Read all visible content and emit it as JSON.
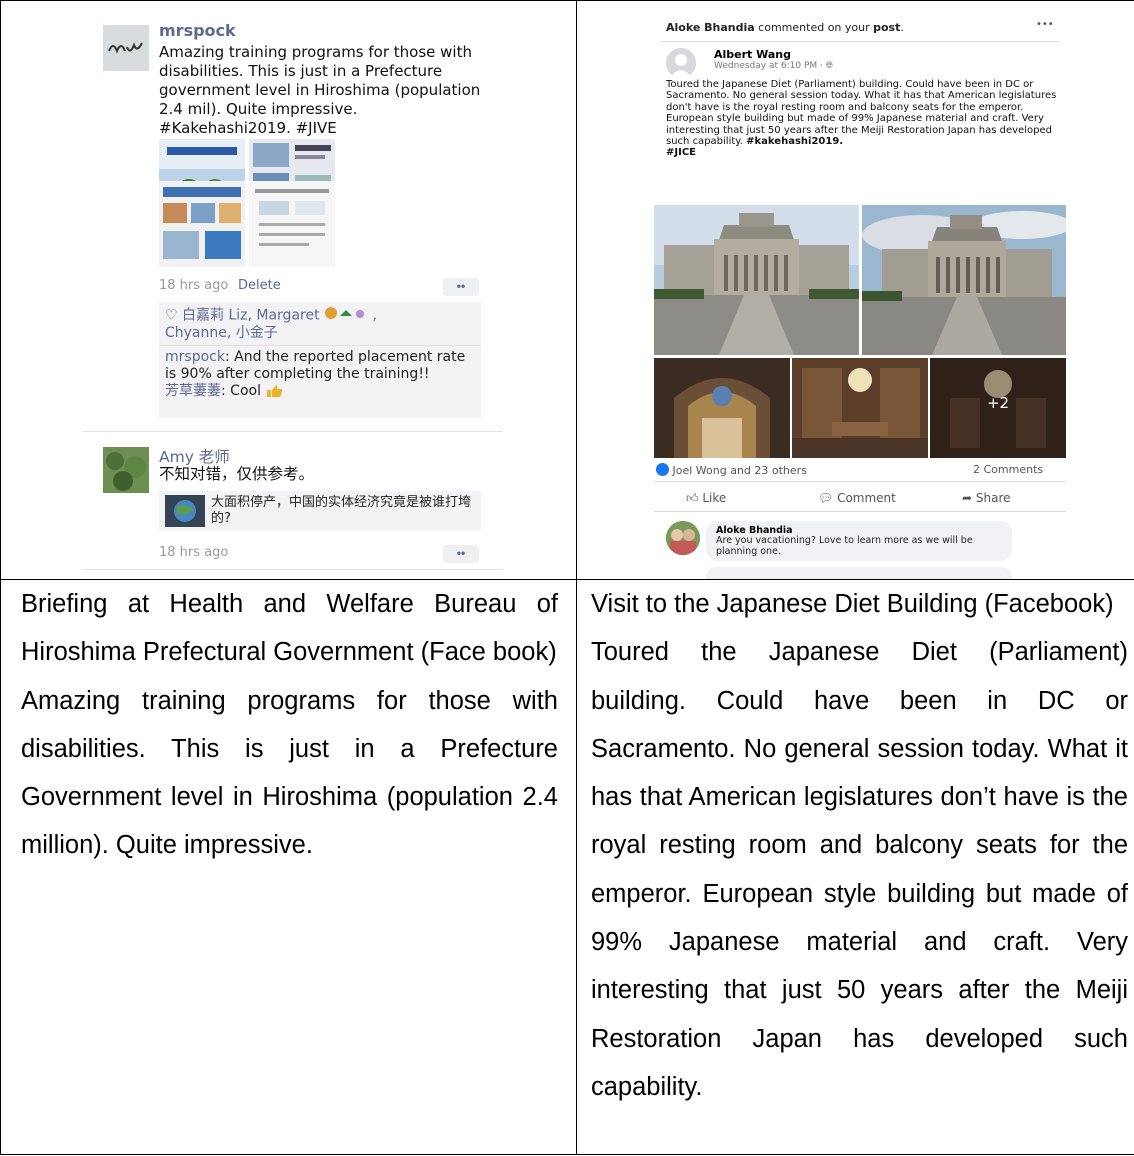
{
  "left_post": {
    "author": "mrspock",
    "body": "Amazing training programs for those with disabilities. This is just in a Prefecture government level in Hiroshima (population 2.4 mil). Quite impressive. #Kakehashi2019. #JIVE",
    "time": "18 hrs ago",
    "delete_label": "Delete",
    "more_label": "••",
    "likes_prefix": "♡ 白嘉莉 Liz, Margaret",
    "likes_tail": ",",
    "likes_line2": "Chyanne, 小金子",
    "comment1_author": "mrspock",
    "comment1_text": ": And the reported placement rate is 90% after completing the training!!",
    "comment2_author": "芳草萋萋",
    "comment2_text": ": Cool",
    "second_author": "Amy 老师",
    "second_text": "不知对错，仅供参考。",
    "share_title": "大面积停产，中国的实体经济究竟是被谁打垮的?",
    "second_time": "18 hrs ago",
    "second_more": "••"
  },
  "right_post": {
    "notif_name": "Aloke Bhandia",
    "notif_mid": " commented on your ",
    "notif_post": "post",
    "notif_end": ".",
    "notif_more": "•••",
    "author": "Albert Wang",
    "meta": "Wednesday at 6:10 PM · ",
    "body": "Toured the Japanese Diet (Parliament) building. Could have been in DC or Sacramento. No general session today. What it has that American legislatures don't have is the royal resting room and balcony seats for the emperor. European style building but made of 99% Japanese material and craft. Very interesting that just 50 years after the Meiji Restoration Japan has developed such capability.",
    "hashtags": "#kakehashi2019.",
    "hashtag2": "#JICE",
    "more_photos": "+2",
    "reactions": "Joel Wong and 23 others",
    "comments_count": "2 Comments",
    "like_label": "Like",
    "comment_label": "Comment",
    "share_label": "Share",
    "commenter": "Aloke Bhandia",
    "comment_text": "Are you vacationing? Love to learn more as we will be planning one."
  },
  "captions": {
    "left_title": "Briefing at Health and Welfare Bureau of Hiroshima Prefectural Government (Face book)",
    "left_body": "Amazing training programs for those with disabilities. This is just in a Prefecture Government level in Hiroshima (population 2.4 million). Quite impressive.",
    "right_title": "Visit to the Japanese Diet Building (Facebook)",
    "right_body": "Toured the Japanese Diet (Parliament) building. Could have been in DC or Sacramento.  No general session today. What it has that American legislatures don’t have is the royal resting room and balcony seats for the emperor.  European style building but made of 99% Japanese material and craft.  Very interesting that just 50 years after the Meiji Restoration Japan has developed such capability."
  }
}
